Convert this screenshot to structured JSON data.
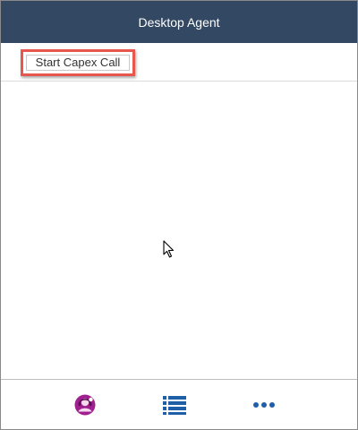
{
  "window": {
    "title": "Desktop Agent"
  },
  "toolbar": {
    "start_call_label": "Start Capex Call"
  },
  "footer": {
    "items": [
      {
        "icon": "agent-avatar-icon",
        "color": "#a0208f"
      },
      {
        "icon": "list-icon",
        "color": "#1f5fa8"
      },
      {
        "icon": "more-horizontal-icon",
        "color": "#1f5fa8"
      }
    ]
  },
  "colors": {
    "header_bg": "#334862",
    "highlight": "#e8574d",
    "accent_blue": "#1f5fa8",
    "accent_purple": "#a0208f"
  }
}
